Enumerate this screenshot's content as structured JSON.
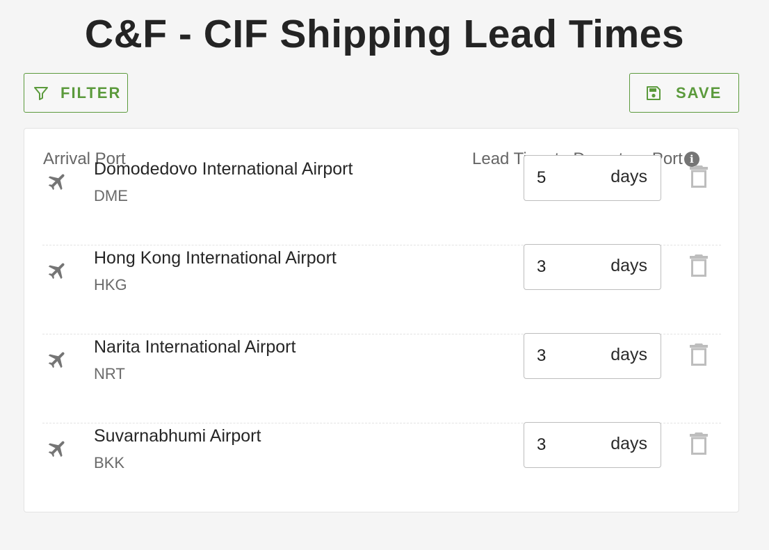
{
  "page": {
    "title": "C&F - CIF Shipping Lead Times"
  },
  "toolbar": {
    "filter_label": "FILTER",
    "save_label": "SAVE"
  },
  "table": {
    "header_arrival": "Arrival Port",
    "header_lead": "Lead Time to Departure Port",
    "info_glyph": "i",
    "rows": [
      {
        "name": "Domodedovo International Airport",
        "code": "DME",
        "lead": "5",
        "unit": "days"
      },
      {
        "name": "Hong Kong International Airport",
        "code": "HKG",
        "lead": "3",
        "unit": "days"
      },
      {
        "name": "Narita International Airport",
        "code": "NRT",
        "lead": "3",
        "unit": "days"
      },
      {
        "name": "Suvarnabhumi Airport",
        "code": "BKK",
        "lead": "3",
        "unit": "days"
      }
    ]
  },
  "icons": {
    "filter": "filter-icon",
    "save": "floppy-disk-icon",
    "plane": "airplane-icon",
    "info": "info-icon",
    "delete": "trash-icon"
  },
  "colors": {
    "accent": "#5b9a3c",
    "background": "#f5f5f5",
    "card": "#ffffff",
    "icon_grey": "#757575",
    "trash_grey": "#bdbdbd"
  }
}
